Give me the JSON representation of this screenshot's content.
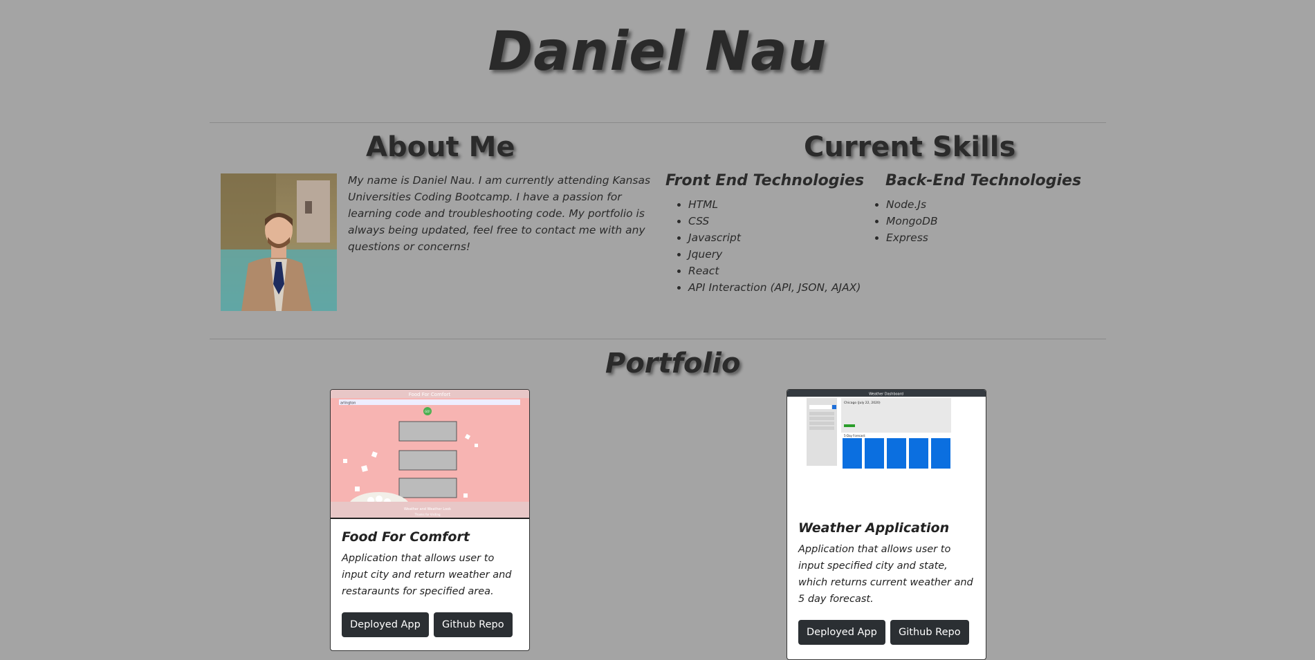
{
  "header": {
    "name": "Daniel Nau"
  },
  "about": {
    "heading": "About Me",
    "text": "My name is Daniel Nau. I am currently attending Kansas Universities Coding Bootcamp. I have a passion for learning code and troubleshooting code. My portfolio is always being updated, feel free to contact me with any questions or concerns!"
  },
  "skills": {
    "heading": "Current Skills",
    "front_end": {
      "heading": "Front End Technologies",
      "items": [
        "HTML",
        "CSS",
        "Javascript",
        "Jquery",
        "React",
        "API Interaction (API, JSON, AJAX)"
      ]
    },
    "back_end": {
      "heading": "Back-End Technologies",
      "items": [
        "Node.Js",
        "MongoDB",
        "Express"
      ]
    }
  },
  "portfolio": {
    "heading": "Portfolio",
    "projects": [
      {
        "title": "Food For Comfort",
        "description": "Application that allows user to input city and return weather and restaraunts for specified area.",
        "deployed_label": "Deployed App",
        "repo_label": "Github Repo",
        "screenshot": {
          "header": "Food For Comfort",
          "search_value": "arlington",
          "go_label": "GO!",
          "footer": "Weather and Weather Look",
          "footer_sub": "Thanks for Visiting"
        }
      },
      {
        "title": "Weather Application",
        "description": "Application that allows user to input specified city and state, which returns current weather and 5 day forecast.",
        "deployed_label": "Deployed App",
        "repo_label": "Github Repo",
        "screenshot": {
          "header": "Weather Dashboard",
          "current_title": "Chicago (July 22, 2020)",
          "forecast_label": "5-Day Forecast:"
        }
      }
    ]
  }
}
